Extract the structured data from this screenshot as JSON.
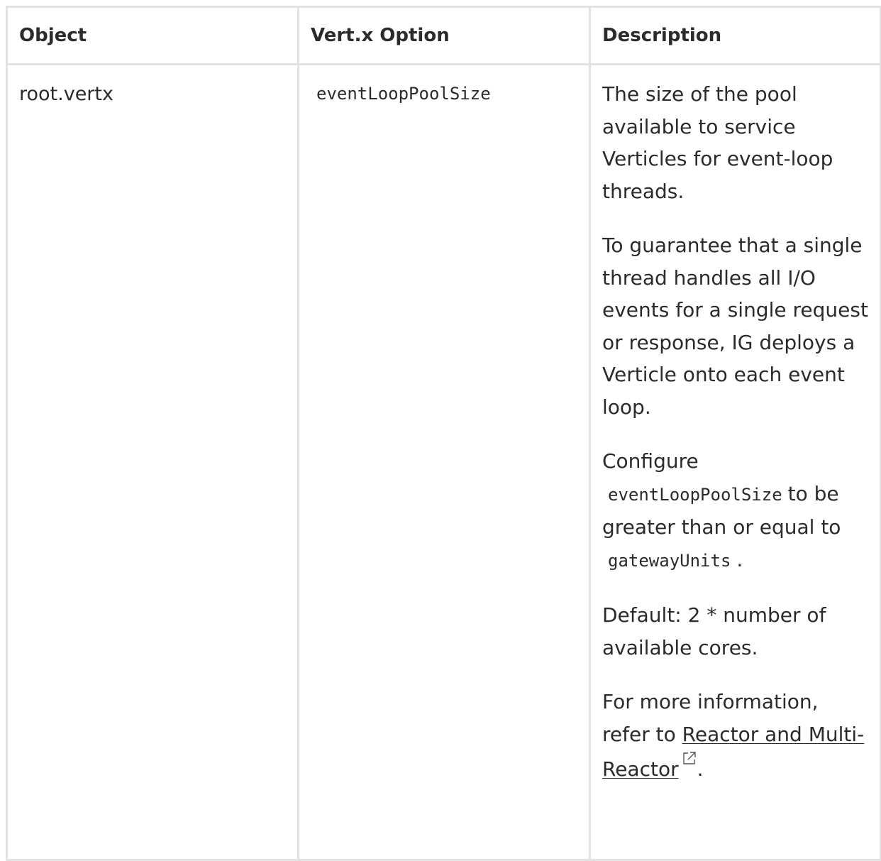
{
  "table": {
    "headers": [
      "Object",
      "Vert.x Option",
      "Description"
    ],
    "row": {
      "object": "root.vertx",
      "option": "eventLoopPoolSize",
      "description": {
        "p1": "The size of the pool available to service Verticles for event-loop threads.",
        "p2": "To guarantee that a single thread handles all I/O events for a single request or response, IG deploys a Verticle onto each event loop.",
        "p3_before": "Configure",
        "p3_code1": "eventLoopPoolSize",
        "p3_middle": "to be greater than or equal to",
        "p3_code2": "gatewayUnits",
        "p3_after": ".",
        "p4": "Default: 2 * number of available cores.",
        "p5_before": "For more information, refer to",
        "p5_link": "Reactor and Multi-Reactor",
        "p5_after": "."
      }
    }
  },
  "icons": {
    "external_link": "external-link-icon"
  },
  "colors": {
    "border": "#e2e2e2",
    "text": "#2b2b2b"
  }
}
